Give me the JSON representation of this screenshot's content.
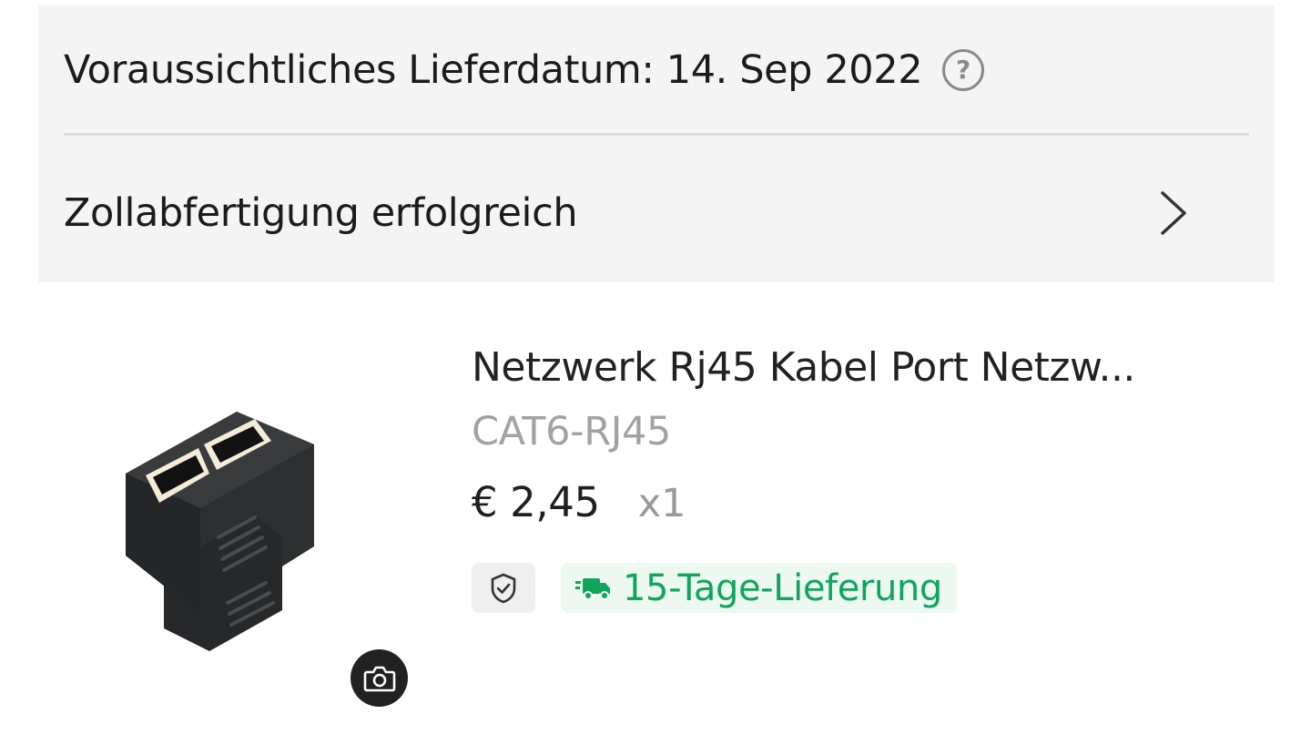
{
  "status_card": {
    "delivery_estimate": "Voraussichtliches Lieferdatum: 14. Sep 2022",
    "help_icon": "question-circle-icon",
    "customs_status": "Zollabfertigung erfolgreich",
    "customs_chevron_icon": "chevron-right-icon"
  },
  "product": {
    "title": "Netzwerk Rj45 Kabel Port Netzw...",
    "sku": "CAT6-RJ45",
    "price": "€ 2,45",
    "quantity": "x1",
    "image_icon": "rj45-splitter-product-image",
    "camera_icon": "camera-icon",
    "guarantee_icon": "shield-check-icon",
    "delivery_icon": "truck-icon",
    "delivery_label": "15-Tage-Lieferung"
  },
  "colors": {
    "card_background": "#f4f4f4",
    "delivery_green": "#0fa65b",
    "delivery_badge_bg": "#edf8f1",
    "muted_text": "#a2a2a2"
  }
}
